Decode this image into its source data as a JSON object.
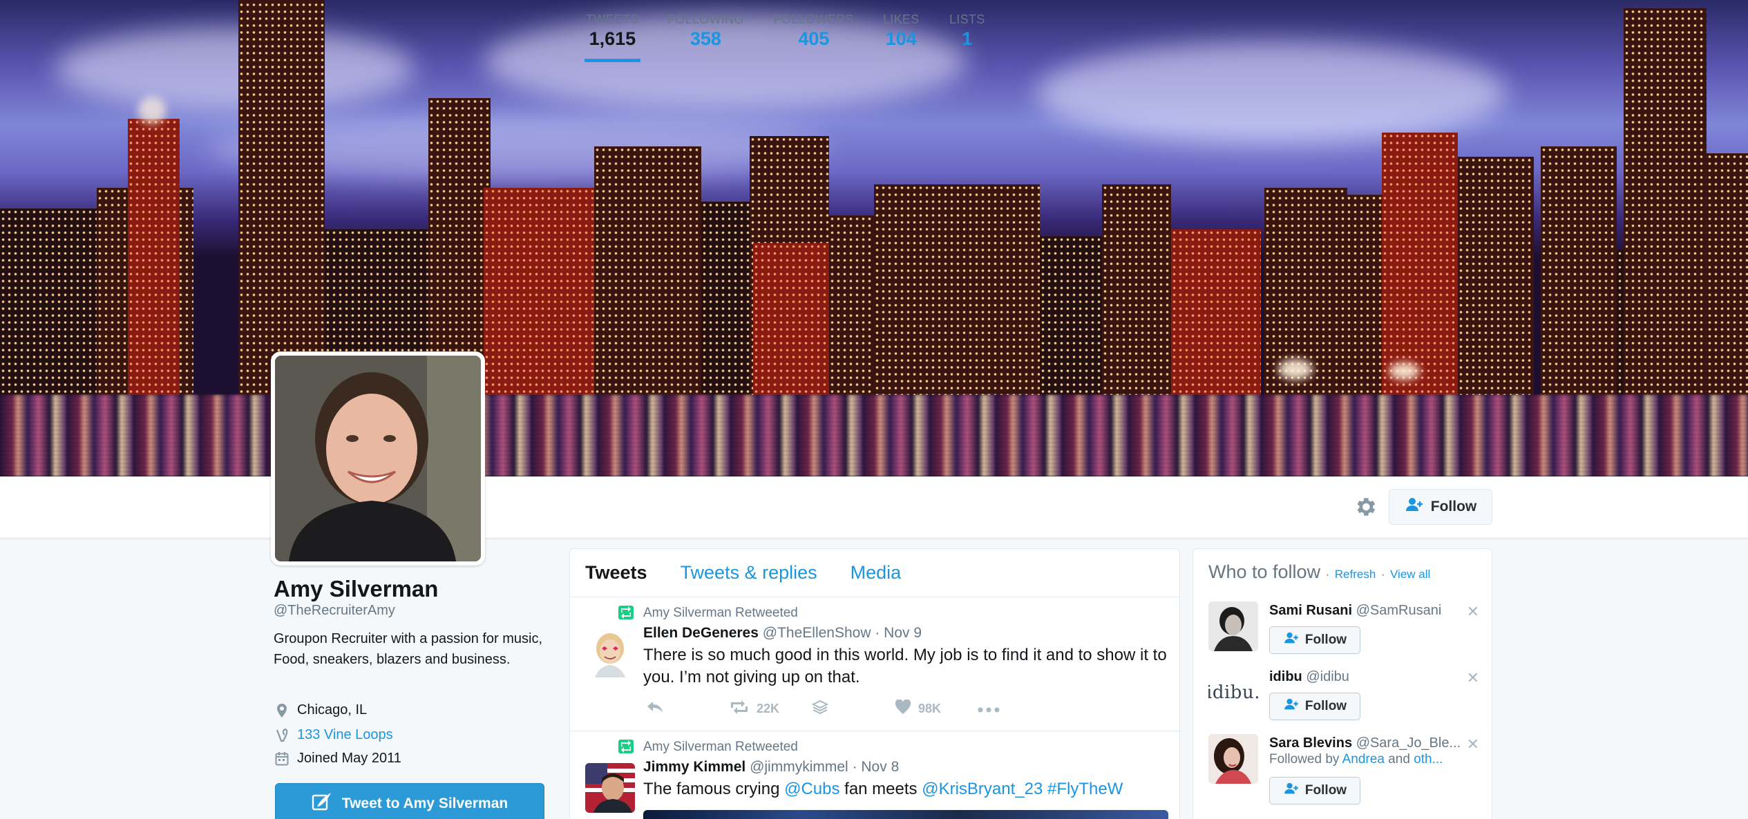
{
  "profile": {
    "name": "Amy Silverman",
    "handle": "@TheRecruiterAmy",
    "bio": "Groupon Recruiter with a passion for music, Food, sneakers, blazers and business.",
    "location": "Chicago, IL",
    "link": "133 Vine Loops",
    "joined": "Joined May 2011",
    "tweet_to_label": "Tweet to Amy Silverman"
  },
  "stats": [
    {
      "label": "TWEETS",
      "value": "1,615"
    },
    {
      "label": "FOLLOWING",
      "value": "358"
    },
    {
      "label": "FOLLOWERS",
      "value": "405"
    },
    {
      "label": "LIKES",
      "value": "104"
    },
    {
      "label": "LISTS",
      "value": "1"
    }
  ],
  "actions": {
    "follow_label": "Follow"
  },
  "timeline": {
    "tabs": [
      "Tweets",
      "Tweets & replies",
      "Media"
    ],
    "tweets": [
      {
        "retweet_note": "Amy Silverman Retweeted",
        "author": "Ellen DeGeneres",
        "handle": "@TheEllenShow",
        "time": "· Nov 9",
        "text": "There is so much good in this world. My job is to find it and to show it to you. I’m not giving up on that.",
        "retweets": "22K",
        "likes": "98K"
      },
      {
        "retweet_note": "Amy Silverman Retweeted",
        "author": "Jimmy Kimmel",
        "handle": "@jimmykimmel",
        "time": "· Nov 8",
        "text_parts": [
          "The famous crying ",
          "@Cubs",
          " fan meets ",
          "@KrisBryant_23",
          " ",
          "#FlyTheW"
        ]
      }
    ]
  },
  "who_to_follow": {
    "title": "Who to follow",
    "refresh": "Refresh",
    "separator": "·",
    "view_all": "View all",
    "users": [
      {
        "name": "Sami Rusani",
        "handle": "@SamRusani",
        "button": "Follow"
      },
      {
        "name": "idibu",
        "handle": "@idibu",
        "button": "Follow",
        "avatar_text": "idibu."
      },
      {
        "name": "Sara Blevins",
        "handle": "@Sara_Jo_Ble...",
        "followed_by_prefix": "Followed by ",
        "followed_by_name": "Andrea",
        "followed_by_suffix": " and ",
        "followed_by_more": "oth...",
        "button": "Follow"
      }
    ]
  },
  "icons": {
    "gear": "gear-icon",
    "location": "location-pin-icon",
    "vine": "vine-icon",
    "calendar": "calendar-icon",
    "follow_person": "person-plus-icon",
    "retweet": "retweet-icon",
    "reply": "reply-icon",
    "like": "heart-icon",
    "more": "more-icon",
    "close": "close-icon",
    "quill": "quill-icon"
  },
  "colors": {
    "accent": "#1b95e0",
    "retweet": "#19cf86",
    "button": "#2b9ad6"
  }
}
